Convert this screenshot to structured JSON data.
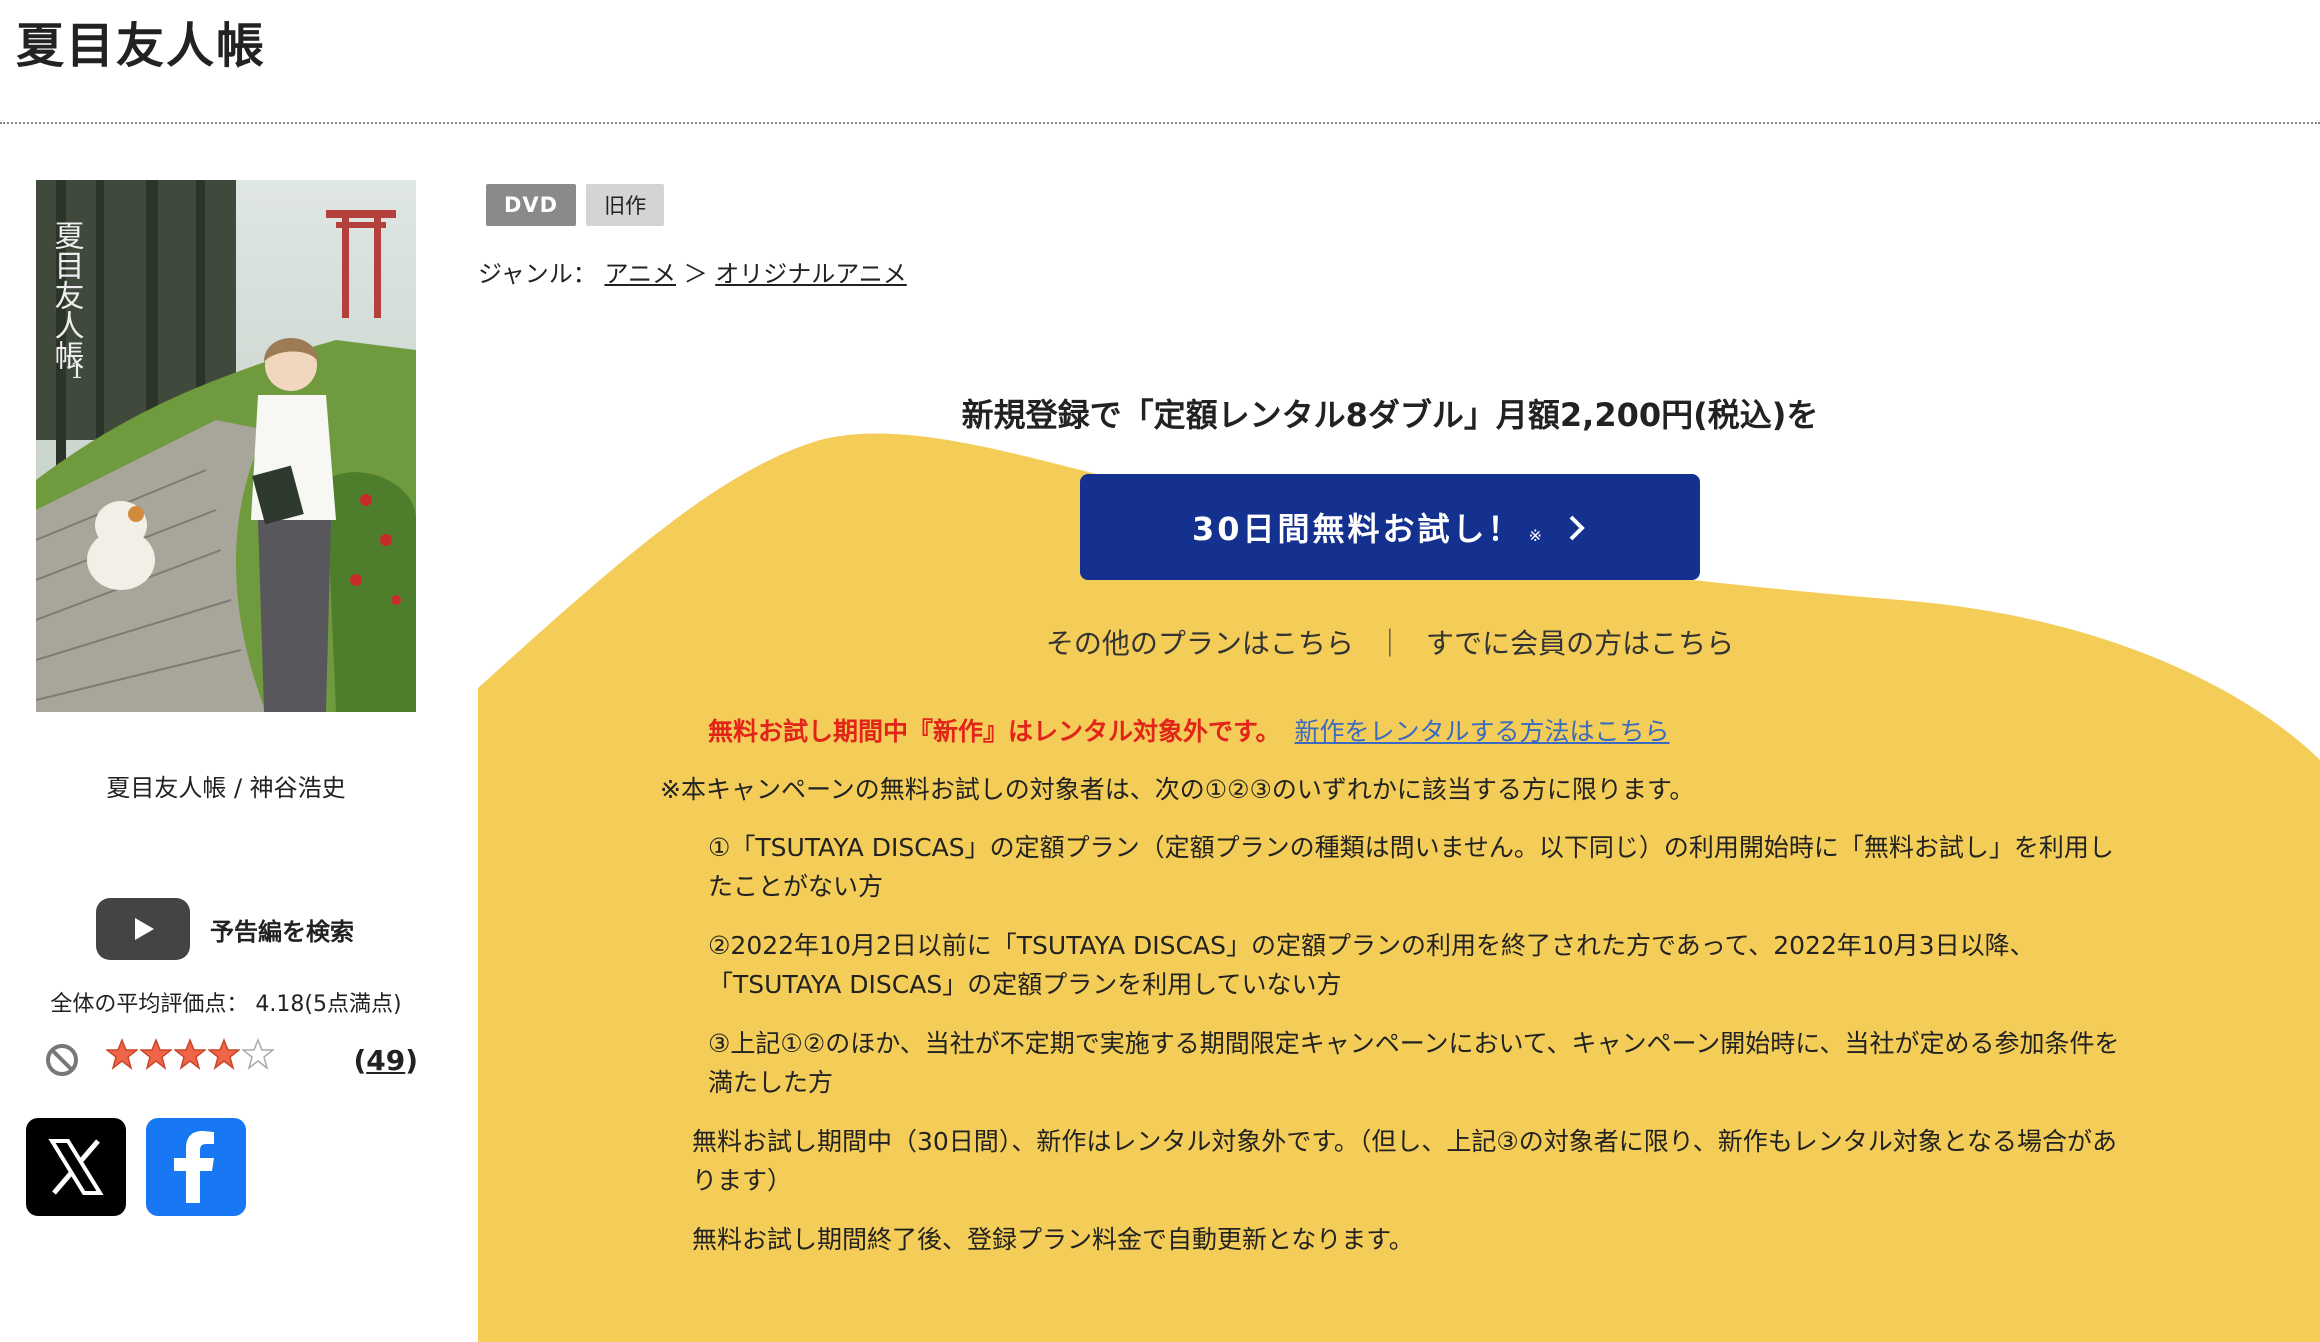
{
  "page_title": "夏目友人帳",
  "cover": {
    "caption": "夏目友人帳 / 神谷浩史",
    "art_title": "夏目友人帳",
    "art_volume": "1"
  },
  "trailer": {
    "icon": "youtube-play-icon",
    "label": "予告編を検索"
  },
  "rating": {
    "text": "全体の平均評価点： 4.18(5点満点)",
    "stars_filled": 4,
    "stars_total": 5,
    "count_prefix": "(",
    "count": "49",
    "count_suffix": ")",
    "star_color": "#ef6548"
  },
  "social": {
    "x_icon": "x-logo-icon",
    "facebook_icon": "facebook-logo-icon"
  },
  "badges": {
    "format": "DVD",
    "age": "旧作"
  },
  "genre": {
    "label": "ジャンル：",
    "items": [
      "アニメ",
      "オリジナルアニメ"
    ],
    "separator": "＞"
  },
  "promo": {
    "headline": "新規登録で「定額レンタル8ダブル」月額2,200円(税込)を",
    "button_label": "30日間無料お試し！",
    "button_note": "※",
    "other_plans": "その他のプランはこちら",
    "separator": "｜",
    "member_login": "すでに会員の方はこちら",
    "warning": "無料お試し期間中『新作』はレンタル対象外です。",
    "warning_link": "新作をレンタルする方法はこちら",
    "note_intro": "※本キャンペーンの無料お試しの対象者は、次の①②③のいずれかに該当する方に限ります。",
    "cond1": "①「TSUTAYA DISCAS」の定額プラン（定額プランの種類は問いません。以下同じ）の利用開始時に「無料お試し」を利用したことがない方",
    "cond2": "②2022年10月2日以前に「TSUTAYA DISCAS」の定額プランの利用を終了された方であって、2022年10月3日以降、「TSUTAYA DISCAS」の定額プランを利用していない方",
    "cond3": "③上記①②のほか、当社が不定期で実施する期間限定キャンペーンにおいて、キャンペーン開始時に、当社が定める参加条件を満たした方",
    "note_trial": "無料お試し期間中（30日間）、新作はレンタル対象外です。（但し、上記③の対象者に限り、新作もレンタル対象となる場合があります）",
    "note_renew": "無料お試し期間終了後、登録プラン料金で自動更新となります。"
  },
  "colors": {
    "promo_yellow": "#f3cd57",
    "button_blue": "#14318f",
    "warning_red": "#e1251b",
    "link_blue": "#3a6bc0"
  }
}
